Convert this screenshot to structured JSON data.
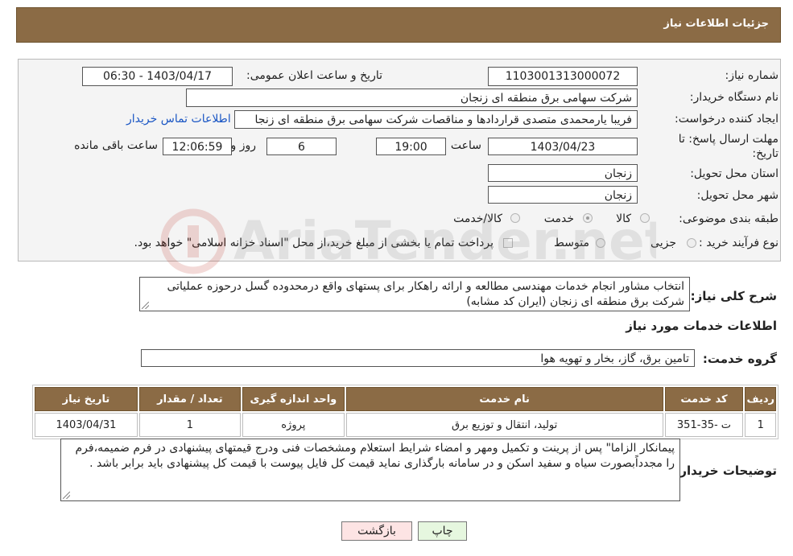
{
  "header": {
    "title": "جزئیات اطلاعات نیاز"
  },
  "form": {
    "need_number_label": "شماره نیاز:",
    "need_number": "1103001313000072",
    "announce_label": "تاریخ و ساعت اعلان عمومی:",
    "announce_value": "1403/04/17 - 06:30",
    "buyer_org_label": "نام دستگاه خریدار:",
    "buyer_org": "شرکت سهامی برق منطقه ای زنجان",
    "creator_label": "ایجاد کننده درخواست:",
    "creator": "فریبا یارمحمدی متصدی قراردادها و مناقصات شرکت سهامی برق منطقه ای زنجا",
    "contact_link": "اطلاعات تماس خریدار",
    "deadline_label_1": "مهلت ارسال پاسخ: تا",
    "deadline_label_2": "تاریخ:",
    "deadline_date": "1403/04/23",
    "hour_label": "ساعت",
    "deadline_hour": "19:00",
    "days_value": "6",
    "days_label": "روز و",
    "remaining_time": "12:06:59",
    "remaining_label": "ساعت باقی مانده",
    "province_label": "استان محل تحویل:",
    "province": "زنجان",
    "city_label": "شهر محل تحویل:",
    "city": "زنجان",
    "category_label": "طبقه بندی موضوعی:",
    "category_options": [
      "کالا",
      "خدمت",
      "کالا/خدمت"
    ],
    "category_selected": "خدمت",
    "process_label": "نوع فرآیند خرید :",
    "process_options": [
      "جزیی",
      "متوسط"
    ],
    "payment_note": "پرداخت تمام یا بخشی از مبلغ خرید،از محل \"اسناد خزانه اسلامی\" خواهد بود."
  },
  "description": {
    "label": "شرح کلی نیاز:",
    "text": "انتخاب مشاور انجام خدمات مهندسی مطالعه و ارائه راهکار برای پستهای واقع درمحدوده گسل درحوزه عملیاتی شرکت برق منطقه ای زنجان (ایران کد مشابه)"
  },
  "services": {
    "section_title": "اطلاعات خدمات مورد نیاز",
    "group_label": "گروه خدمت:",
    "group_value": "تامین برق، گاز، بخار و تهویه هوا",
    "table": {
      "headers": [
        "ردیف",
        "کد خدمت",
        "نام خدمت",
        "واحد اندازه گیری",
        "تعداد / مقدار",
        "تاریخ نیاز"
      ],
      "rows": [
        [
          "1",
          "ت -35-351",
          "تولید، انتقال و توزیع برق",
          "پروژه",
          "1",
          "1403/04/31"
        ]
      ]
    }
  },
  "buyer_notes": {
    "label": "توضیحات خریدار:",
    "text": "پیمانکار الزاما\" پس از پرینت و تکمیل ومهر و امضاء شرایط استعلام ومشخصات فنی ودرج قیمتهای پیشنهادی در فرم ضمیمه،فرم را مجدداًبصورت سیاه و سفید اسکن و در سامانه بارگذاری نماید قیمت کل فایل پیوست با قیمت کل پیشنهادی باید برابر باشد ."
  },
  "buttons": {
    "print": "چاپ",
    "back": "بازگشت"
  },
  "watermark": {
    "text": "AriaTender.net"
  },
  "colors": {
    "header": "#8b6b45",
    "back_button": "#fde4e4",
    "print_button": "#e6f7df",
    "link": "#1a56c4"
  }
}
